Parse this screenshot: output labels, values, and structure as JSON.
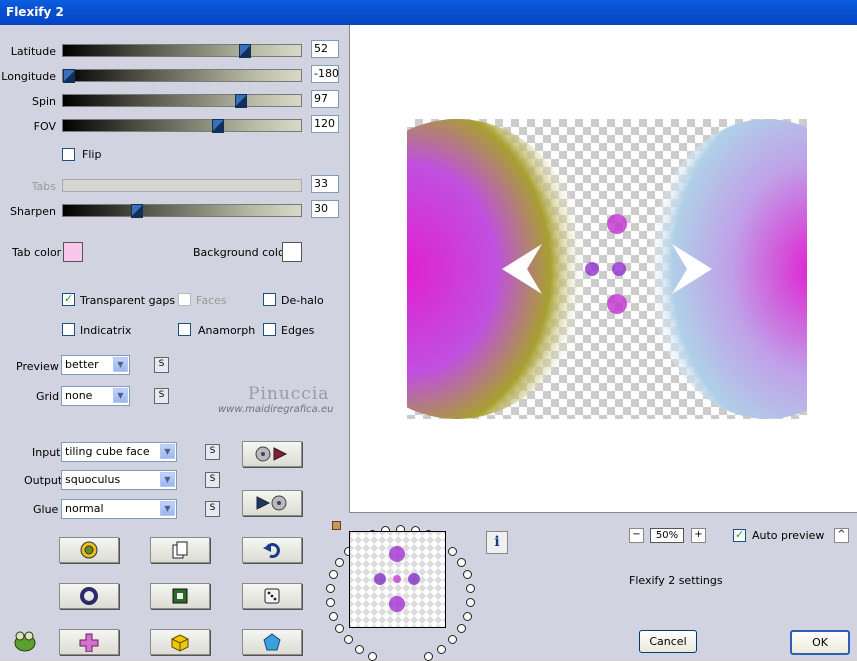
{
  "window": {
    "title": "Flexify 2"
  },
  "sliders": [
    {
      "label": "Latitude",
      "value": "52",
      "fraction": 0.78,
      "disabled": false
    },
    {
      "label": "Longitude",
      "value": "-180",
      "fraction": 0.0,
      "disabled": false
    },
    {
      "label": "Spin",
      "value": "97",
      "fraction": 0.76,
      "disabled": false
    },
    {
      "label": "FOV",
      "value": "120",
      "fraction": 0.66,
      "disabled": false
    },
    {
      "label": "Tabs",
      "value": "33",
      "fraction": 0.33,
      "disabled": true
    },
    {
      "label": "Sharpen",
      "value": "30",
      "fraction": 0.3,
      "disabled": false
    }
  ],
  "flip": {
    "label": "Flip",
    "checked": false
  },
  "colors": {
    "tab_color_label": "Tab color",
    "tab_color": "#f8c8ec",
    "background_color_label": "Background color",
    "background_color": "#ffffff"
  },
  "options": {
    "transparent_gaps": {
      "label": "Transparent gaps",
      "checked": true
    },
    "faces": {
      "label": "Faces",
      "checked": false,
      "disabled": true
    },
    "de_halo": {
      "label": "De-halo",
      "checked": false
    },
    "indicatrix": {
      "label": "Indicatrix",
      "checked": false
    },
    "anamorph": {
      "label": "Anamorph",
      "checked": false
    },
    "edges": {
      "label": "Edges",
      "checked": false
    }
  },
  "dropdowns": {
    "preview": {
      "label": "Preview",
      "value": "better"
    },
    "grid": {
      "label": "Grid",
      "value": "none"
    },
    "input": {
      "label": "Input",
      "value": "tiling cube face"
    },
    "output": {
      "label": "Output",
      "value": "squoculus"
    },
    "glue": {
      "label": "Glue",
      "value": "normal"
    }
  },
  "s_label": "S",
  "watermark": {
    "name": "Pinuccia",
    "site": "www.maidiregrafica.eu"
  },
  "icons": {
    "to_input": "disc-arrow-icon",
    "to_output": "arrow-disc-icon",
    "randomize": "flower-icon",
    "copy": "pages-icon",
    "undo": "undo-arrow-icon",
    "ring": "ring-icon",
    "frame": "square-frame-icon",
    "dice": "dice-icon",
    "cross": "cross-shape-icon",
    "cube": "cube-icon",
    "pentagon": "pentagon-icon",
    "info": "info-icon",
    "logo": "frog-logo-icon"
  },
  "info_label": "i",
  "zoom": {
    "minus": "−",
    "value": "50%",
    "plus": "+"
  },
  "auto_preview": {
    "label": "Auto preview",
    "checked": true
  },
  "caret_label": "^",
  "settings_label": "Flexify 2 settings",
  "buttons": {
    "cancel": "Cancel",
    "ok": "OK"
  },
  "check_glyph": "✓",
  "dropdown_arrow": "▼"
}
